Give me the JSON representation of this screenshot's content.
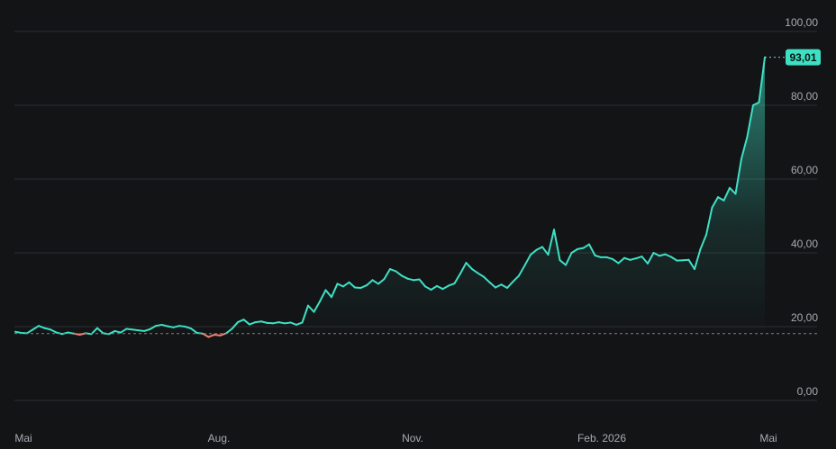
{
  "chart_data": {
    "type": "area",
    "title": "",
    "xlabel": "",
    "ylabel": "",
    "ylim": [
      0,
      100
    ],
    "yticks": [
      0,
      20,
      40,
      60,
      80,
      100
    ],
    "ytick_labels": [
      "0,00",
      "20,00",
      "40,00",
      "60,00",
      "80,00",
      "100,00"
    ],
    "xtick_labels": [
      "Mai",
      "Aug.",
      "Nov.",
      "Feb. 2026",
      "Mai"
    ],
    "reference_value": 18.1,
    "last_value": 93.01,
    "last_value_label": "93,01",
    "grid": true,
    "colors": {
      "background": "#131416",
      "up": "#3ee0c4",
      "down": "#f07f72",
      "reference": "#7d8086",
      "grid": "#2c2e32",
      "axis_text": "#a7abb1"
    },
    "series": [
      {
        "values": [
          18.6,
          18.3,
          18.2,
          19.2,
          20.2,
          19.6,
          19.2,
          18.4,
          18.0,
          18.4,
          18.1,
          17.8,
          18.2,
          18.0,
          19.6,
          18.2,
          18.0,
          18.8,
          18.4,
          19.4,
          19.2,
          19.0,
          18.8,
          19.3,
          20.2,
          20.5,
          20.1,
          19.8,
          20.2,
          20.0,
          19.5,
          18.3,
          18.1,
          17.2,
          17.8,
          17.6,
          18.2,
          19.4,
          21.2,
          21.9,
          20.6,
          21.2,
          21.4,
          21.0,
          20.9,
          21.2,
          20.9,
          21.1,
          20.5,
          21.1,
          25.7,
          24.0,
          26.8,
          29.9,
          28.0,
          31.6,
          30.9,
          32.0,
          30.6,
          30.5,
          31.2,
          32.6,
          31.6,
          32.9,
          35.6,
          35.0,
          33.8,
          33.0,
          32.6,
          32.8,
          30.9,
          30.0,
          31.0,
          30.2,
          31.1,
          31.7,
          34.4,
          37.3,
          35.6,
          34.5,
          33.5,
          32.0,
          30.6,
          31.4,
          30.5,
          32.2,
          33.8,
          36.6,
          39.5,
          40.8,
          41.6,
          39.5,
          46.3,
          38.0,
          36.7,
          40.0,
          41.0,
          41.3,
          42.3,
          39.3,
          38.8,
          38.8,
          38.3,
          37.2,
          38.6,
          38.1,
          38.5,
          39.0,
          37.1,
          40.0,
          39.2,
          39.6,
          38.9,
          37.9,
          38.0,
          38.1,
          35.6,
          41.0,
          44.9,
          52.3,
          55.1,
          54.2,
          57.6,
          56.0,
          65.5,
          71.5,
          80.0,
          80.8,
          93.01
        ]
      }
    ]
  }
}
